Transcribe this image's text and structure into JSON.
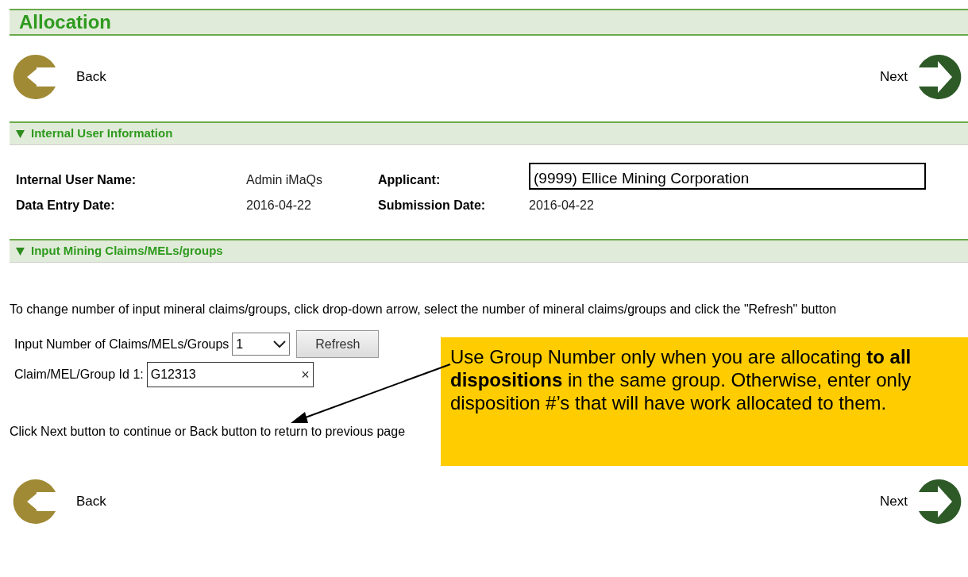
{
  "title": "Allocation",
  "nav_top": {
    "back": "Back",
    "next": "Next"
  },
  "user_info": {
    "title": "Internal User Information",
    "expanded": true,
    "fields": [
      {
        "label": "Internal User Name:",
        "value": "Admin iMaQs",
        "kind": "plain"
      },
      {
        "label": "Applicant:",
        "value": "(9999) Ellice Mining Corporation",
        "kind": "boxed"
      },
      {
        "label": "Data Entry Date:",
        "value": "2016-04-22",
        "kind": "plain"
      },
      {
        "label": "Submission Date:",
        "value": "2016-04-22",
        "kind": "plain"
      }
    ]
  },
  "claims": {
    "title": "Input Mining Claims/MELs/groups",
    "expanded": true,
    "instructions": "To change number of input mineral claims/groups, click drop-down arrow, select the number of mineral claims/groups and click the \"Refresh\" button",
    "count_label": "Input Number of Claims/MELs/Groups",
    "count_value": "1",
    "refresh": "Refresh",
    "id_label": "Claim/MEL/Group Id 1:",
    "id_value": "G12313",
    "clear": "×",
    "footer": "Click Next button to continue or Back button to return to previous page"
  },
  "nav_bottom": {
    "back": "Back",
    "next": "Next"
  },
  "callout": "Use Group Number only when you are allocating **to all dispositions** in the same group. Otherwise, enter only disposition #’s that will have work allocated to them."
}
